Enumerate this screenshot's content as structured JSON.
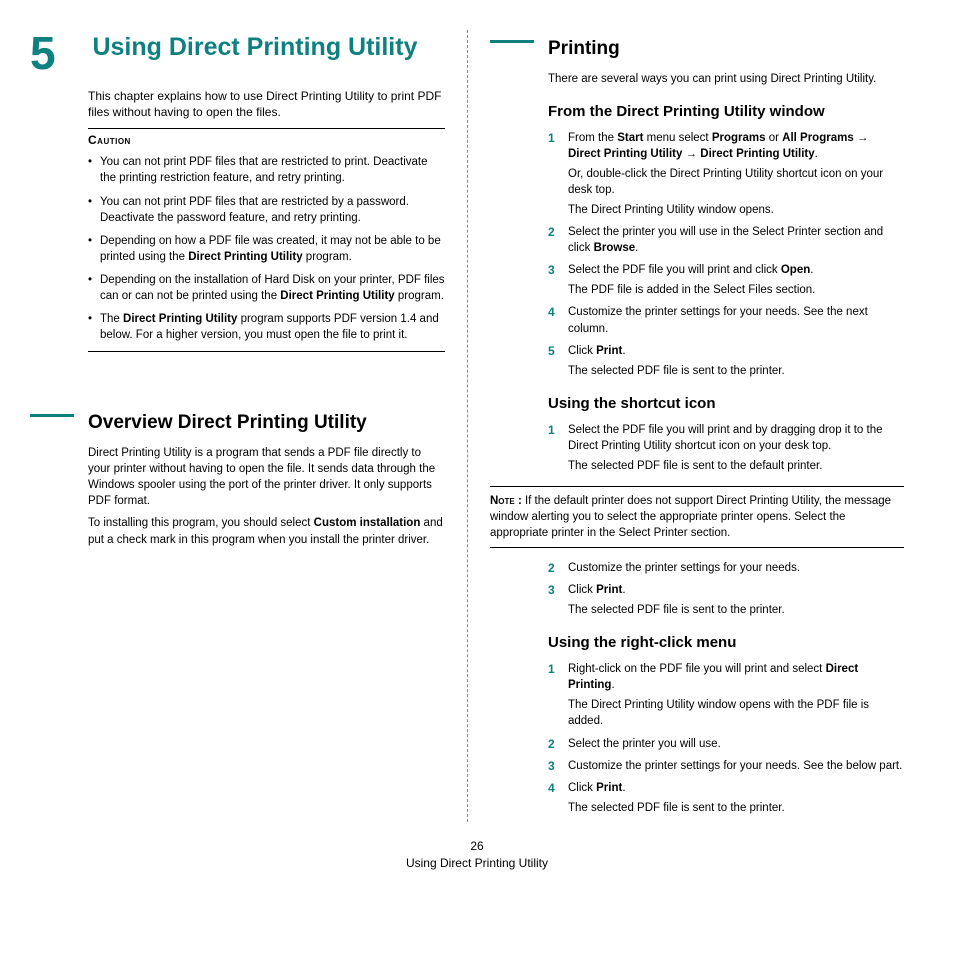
{
  "chapter": {
    "number": "5",
    "title": "Using Direct Printing Utility"
  },
  "intro": "This chapter explains how to use Direct Printing Utility to print PDF files without having to open the files.",
  "caution": {
    "label": "Caution",
    "items": [
      {
        "pre": "You can not print PDF files that are restricted to print. Deactivate the printing restriction feature, and retry printing."
      },
      {
        "pre": "You can not print PDF files that are restricted by a password. Deactivate the password feature, and retry printing."
      },
      {
        "pre": "Depending on how a PDF file was created, it may not be able to be printed using the ",
        "b1": "Direct Printing Utility",
        "post": " program."
      },
      {
        "pre": "Depending on the installation of Hard Disk on your printer, PDF files can or can not be printed using the ",
        "b1": "Direct Printing Utility",
        "post": " program."
      },
      {
        "pre": "The ",
        "b1": "Direct Printing Utility",
        "post": " program supports PDF version 1.4 and below. For a higher version, you must open the file to print it."
      }
    ]
  },
  "overview": {
    "heading": "Overview Direct Printing Utility",
    "p1": "Direct Printing Utility is a program that sends a PDF file directly to your printer without having to open the file. It sends data through the Windows spooler using the port of the printer driver. It only supports PDF format.",
    "p2_pre": "To installing this program, you should select ",
    "p2_b": "Custom installation",
    "p2_post": " and put a check mark in this program when you install the printer driver."
  },
  "printing": {
    "heading": "Printing",
    "intro": "There are several ways you can print using Direct Printing Utility.",
    "from_window": {
      "heading": "From the Direct Printing Utility window",
      "step1": {
        "t1": "From the ",
        "b1": "Start",
        "t2": " menu select ",
        "b2": "Programs",
        "t3": " or ",
        "b3": "All Programs",
        "t4": " ",
        "b4": "Direct Printing Utility",
        "t5": " ",
        "b5": "Direct Printing Utility",
        "t6": ".",
        "sub1": "Or, double-click the Direct Printing Utility shortcut icon on your desk top.",
        "sub2": "The Direct Printing Utility window opens."
      },
      "step2": {
        "t1": "Select the printer you will use in the Select Printer section and click ",
        "b1": "Browse",
        "t2": "."
      },
      "step3": {
        "t1": "Select the PDF file you will print and click ",
        "b1": "Open",
        "t2": ".",
        "sub1": "The PDF file is added in the Select Files section."
      },
      "step4": {
        "t1": "Customize the printer settings for your needs. See the next column."
      },
      "step5": {
        "t1": "Click ",
        "b1": "Print",
        "t2": ".",
        "sub1": "The selected PDF file is sent to the printer."
      }
    },
    "shortcut": {
      "heading": "Using the shortcut icon",
      "step1": {
        "t1": "Select the PDF file you will print and by dragging drop it to the Direct Printing Utility shortcut icon on your desk top.",
        "sub1": "The selected PDF file is sent to the default printer."
      },
      "note_label": "Note :",
      "note_text": " If the default printer does not support Direct Printing Utility, the message window alerting you to select the appropriate printer opens. Select the appropriate printer in the Select Printer section.",
      "step2": {
        "t1": "Customize the printer settings for your needs."
      },
      "step3": {
        "t1": "Click ",
        "b1": "Print",
        "t2": ".",
        "sub1": "The selected PDF file is sent to the printer."
      }
    },
    "rightclick": {
      "heading": "Using the right-click menu",
      "step1": {
        "t1": "Right-click on the PDF file you will print and select ",
        "b1": "Direct Printing",
        "t2": ".",
        "sub1": "The Direct Printing Utility window opens with the PDF file is added."
      },
      "step2": {
        "t1": "Select the printer you will use."
      },
      "step3": {
        "t1": "Customize the printer settings for your needs. See the below part."
      },
      "step4": {
        "t1": "Click ",
        "b1": "Print",
        "t2": ".",
        "sub1": "The selected PDF file is sent to the printer."
      }
    }
  },
  "footer": {
    "page": "26",
    "title": "Using Direct Printing Utility"
  }
}
